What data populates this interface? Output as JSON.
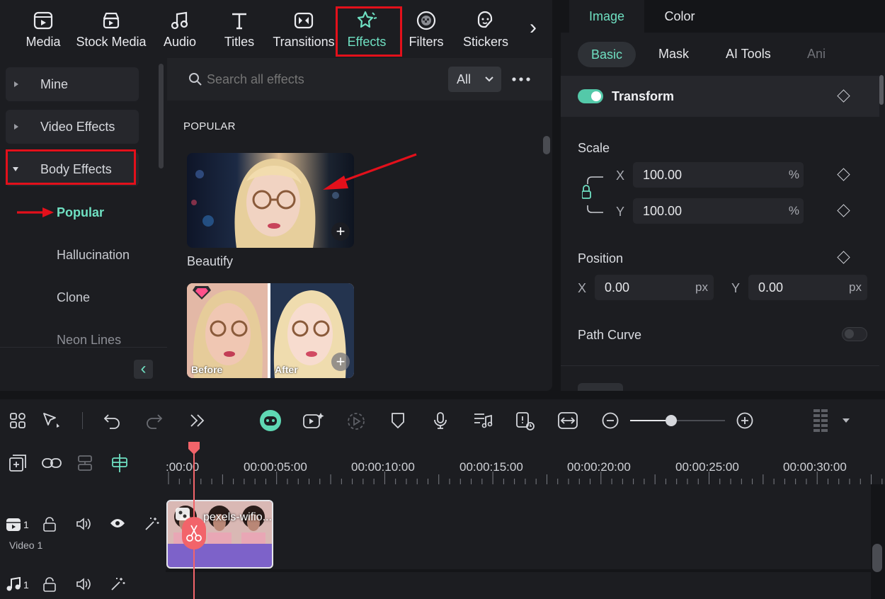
{
  "toolbar": {
    "tabs": [
      {
        "label": "Media",
        "icon": "media-icon"
      },
      {
        "label": "Stock Media",
        "icon": "stock-media-icon"
      },
      {
        "label": "Audio",
        "icon": "audio-icon"
      },
      {
        "label": "Titles",
        "icon": "titles-icon"
      },
      {
        "label": "Transitions",
        "icon": "transitions-icon"
      },
      {
        "label": "Effects",
        "icon": "effects-icon",
        "active": true
      },
      {
        "label": "Filters",
        "icon": "filters-icon"
      },
      {
        "label": "Stickers",
        "icon": "stickers-icon"
      }
    ],
    "more_glyph": "›"
  },
  "tree": {
    "categories": [
      {
        "label": "Mine",
        "expanded": false
      },
      {
        "label": "Video Effects",
        "expanded": false
      },
      {
        "label": "Body Effects",
        "expanded": true
      }
    ],
    "subitems": [
      {
        "label": "Popular",
        "active": true
      },
      {
        "label": "Hallucination"
      },
      {
        "label": "Clone"
      },
      {
        "label": "Neon Lines"
      }
    ],
    "collapse_glyph": "‹"
  },
  "effects": {
    "search_placeholder": "Search all effects",
    "filter_value": "All",
    "section_title": "POPULAR",
    "items": [
      {
        "name": "Beautify"
      },
      {
        "name": "",
        "before_label": "Before",
        "after_label": "After"
      }
    ]
  },
  "properties": {
    "top_tabs": [
      "Image",
      "Color"
    ],
    "active_top_tab": "Image",
    "sub_tabs": [
      "Basic",
      "Mask",
      "AI Tools",
      "Ani"
    ],
    "active_sub_tab": "Basic",
    "transform_label": "Transform",
    "scale_label": "Scale",
    "scale_x": {
      "axis": "X",
      "value": "100.00",
      "unit": "%"
    },
    "scale_y": {
      "axis": "Y",
      "value": "100.00",
      "unit": "%"
    },
    "position_label": "Position",
    "position_x": {
      "axis": "X",
      "value": "0.00",
      "unit": "px"
    },
    "position_y": {
      "axis": "Y",
      "value": "0.00",
      "unit": "px"
    },
    "path_curve_label": "Path Curve"
  },
  "timeline": {
    "ruler": [
      ":00:00",
      "00:00:05:00",
      "00:00:10:00",
      "00:00:15:00",
      "00:00:20:00",
      "00:00:25:00",
      "00:00:30:00"
    ],
    "video_track": {
      "number": "1",
      "name": "Video 1"
    },
    "audio_track": {
      "number": "1"
    },
    "clip_title": "pexels-wifio...",
    "zoom_level": 0.43
  },
  "colors": {
    "accent": "#6fe0c2",
    "highlight": "#e3101b",
    "playhead": "#f2646a",
    "clip": "#7d62c9"
  }
}
